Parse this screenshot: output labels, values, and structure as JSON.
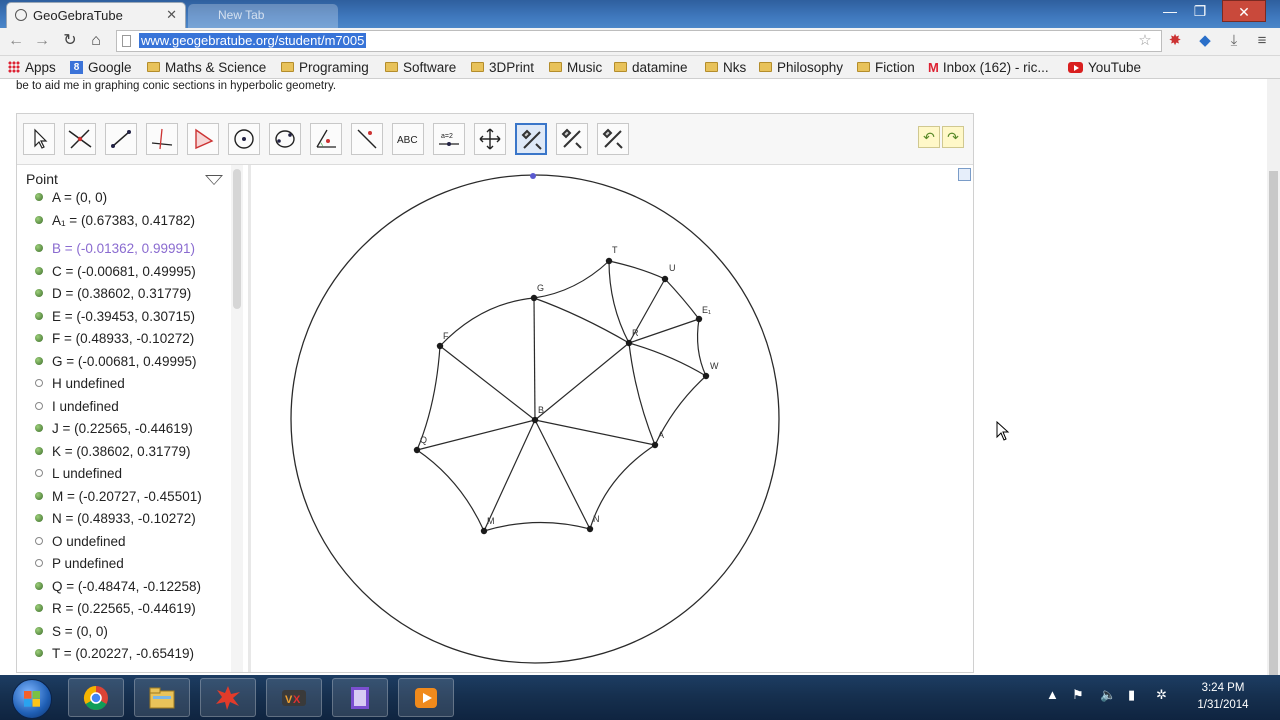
{
  "browser": {
    "tab_title": "GeoGebraTube",
    "tab2_title": "New Tab",
    "url": "www.geogebratube.org/student/m7005",
    "window_controls": [
      "—",
      "❐",
      "✕"
    ]
  },
  "bookmarks": [
    {
      "label": "Apps",
      "icon": "apps-grid-icon"
    },
    {
      "label": "Google",
      "icon": "google-icon"
    },
    {
      "label": "Maths & Science",
      "icon": "folder-icon"
    },
    {
      "label": "Programing",
      "icon": "folder-icon"
    },
    {
      "label": "Software",
      "icon": "folder-icon"
    },
    {
      "label": "3DPrint",
      "icon": "folder-icon"
    },
    {
      "label": "Music",
      "icon": "folder-icon"
    },
    {
      "label": "datamine",
      "icon": "folder-icon"
    },
    {
      "label": "Nks",
      "icon": "folder-icon"
    },
    {
      "label": "Philosophy",
      "icon": "folder-icon"
    },
    {
      "label": "Fiction",
      "icon": "folder-icon"
    },
    {
      "label": "Inbox (162) - ric...",
      "icon": "gmail-icon"
    },
    {
      "label": "YouTube",
      "icon": "youtube-icon"
    }
  ],
  "page": {
    "intro_text": "be to aid me in graphing conic sections in hyperbolic geometry."
  },
  "ggb_toolbar": {
    "tools": [
      "move-tool",
      "point-on-object-tool",
      "segment-tool",
      "perpendicular-line-tool",
      "polygon-tool",
      "circle-tool",
      "conic-tool",
      "angle-tool",
      "reflect-tool",
      "text-tool",
      "slider-tool",
      "move-graphics-tool",
      "custom-tool-1",
      "custom-tool-2",
      "custom-tool-3"
    ],
    "text_tool_label": "ABC",
    "slider_tool_label": "a=2",
    "selected_tool": "custom-tool-1"
  },
  "algebra": {
    "header": "Point",
    "rows": [
      {
        "text": "A = (0, 0)",
        "defined": true,
        "selected": false
      },
      {
        "text": "A₁ = (0.67383, 0.41782)",
        "defined": true,
        "selected": false
      },
      {
        "text": "B = (-0.01362, 0.99991)",
        "defined": true,
        "selected": true
      },
      {
        "text": "C = (-0.00681, 0.49995)",
        "defined": true,
        "selected": false
      },
      {
        "text": "D = (0.38602, 0.31779)",
        "defined": true,
        "selected": false
      },
      {
        "text": "E = (-0.39453, 0.30715)",
        "defined": true,
        "selected": false
      },
      {
        "text": "F = (0.48933, -0.10272)",
        "defined": true,
        "selected": false
      },
      {
        "text": "G = (-0.00681, 0.49995)",
        "defined": true,
        "selected": false
      },
      {
        "text": "H undefined",
        "defined": false,
        "selected": false
      },
      {
        "text": "I undefined",
        "defined": false,
        "selected": false
      },
      {
        "text": "J = (0.22565, -0.44619)",
        "defined": true,
        "selected": false
      },
      {
        "text": "K = (0.38602, 0.31779)",
        "defined": true,
        "selected": false
      },
      {
        "text": "L undefined",
        "defined": false,
        "selected": false
      },
      {
        "text": "M = (-0.20727, -0.45501)",
        "defined": true,
        "selected": false
      },
      {
        "text": "N = (0.48933, -0.10272)",
        "defined": true,
        "selected": false
      },
      {
        "text": "O undefined",
        "defined": false,
        "selected": false
      },
      {
        "text": "P undefined",
        "defined": false,
        "selected": false
      },
      {
        "text": "Q = (-0.48474, -0.12258)",
        "defined": true,
        "selected": false
      },
      {
        "text": "R = (0.22565, -0.44619)",
        "defined": true,
        "selected": false
      },
      {
        "text": "S = (0, 0)",
        "defined": true,
        "selected": false
      },
      {
        "text": "T = (0.20227, -0.65419)",
        "defined": true,
        "selected": false
      }
    ]
  },
  "graphics": {
    "point_labels": [
      "T",
      "U",
      "E₁",
      "G",
      "F",
      "R",
      "W",
      "A",
      "Q",
      "N",
      "M",
      "B"
    ],
    "colors": {
      "stroke": "#2a2a2a",
      "point": "#1a1a1a",
      "highlight": "#5a5ad0"
    }
  },
  "taskbar": {
    "apps": [
      "chrome-icon",
      "explorer-folder-icon",
      "burst-app-icon",
      "media-player-icon",
      "document-app-icon",
      "vlc-play-icon"
    ],
    "time": "3:24 PM",
    "date": "1/31/2014"
  }
}
